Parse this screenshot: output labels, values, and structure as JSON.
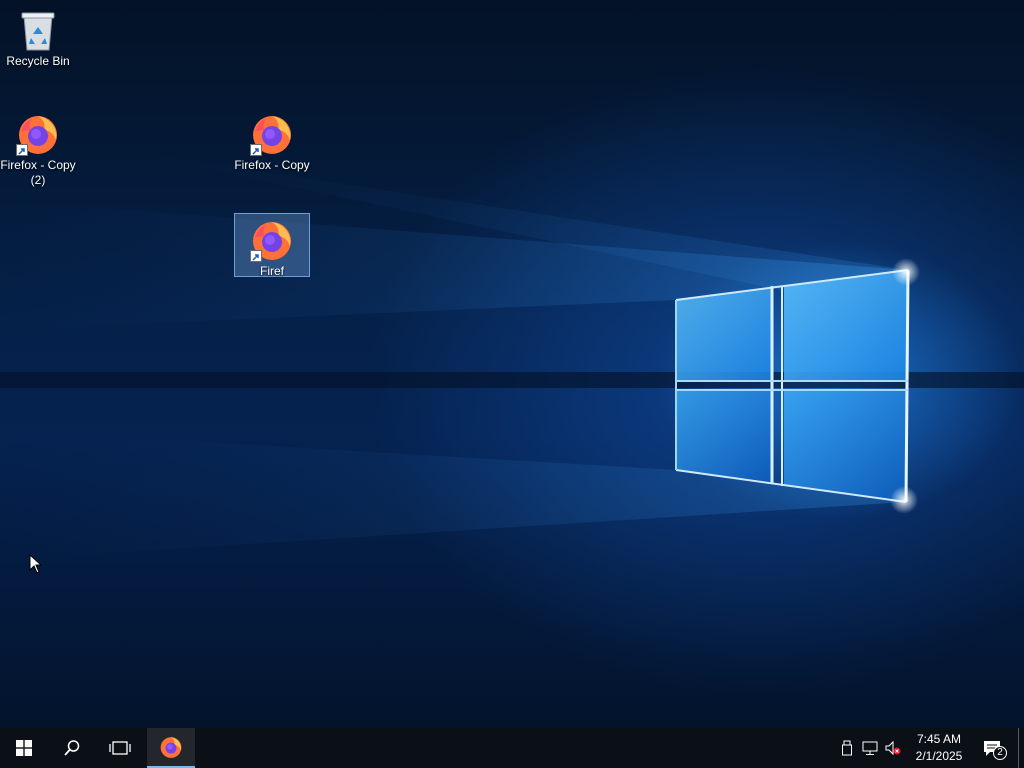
{
  "desktop": {
    "icons": [
      {
        "label": "Recycle Bin",
        "icon": "recycle-bin-icon",
        "selected": false
      },
      {
        "label": "Firefox - Copy (2)",
        "icon": "firefox-icon",
        "shortcut": true,
        "selected": false
      },
      {
        "label": "Firefox - Copy",
        "icon": "firefox-icon",
        "shortcut": true,
        "selected": false
      },
      {
        "label": "Firef",
        "icon": "firefox-icon",
        "shortcut": true,
        "selected": true
      }
    ]
  },
  "taskbar": {
    "start_icon": "windows-logo-icon",
    "search_icon": "search-icon",
    "task_view_icon": "task-view-icon",
    "pinned_apps": [
      {
        "name": "firefox-icon",
        "active": true
      }
    ],
    "tray": {
      "icons": [
        "usb-device-icon",
        "network-icon",
        "volume-muted-icon"
      ],
      "time": "7:45 AM",
      "date": "2/1/2025",
      "notifications_count": "2"
    }
  },
  "colors": {
    "taskbar_bg": "#0b0f16",
    "selection": "#78aae6",
    "accent": "#76b9ed"
  }
}
